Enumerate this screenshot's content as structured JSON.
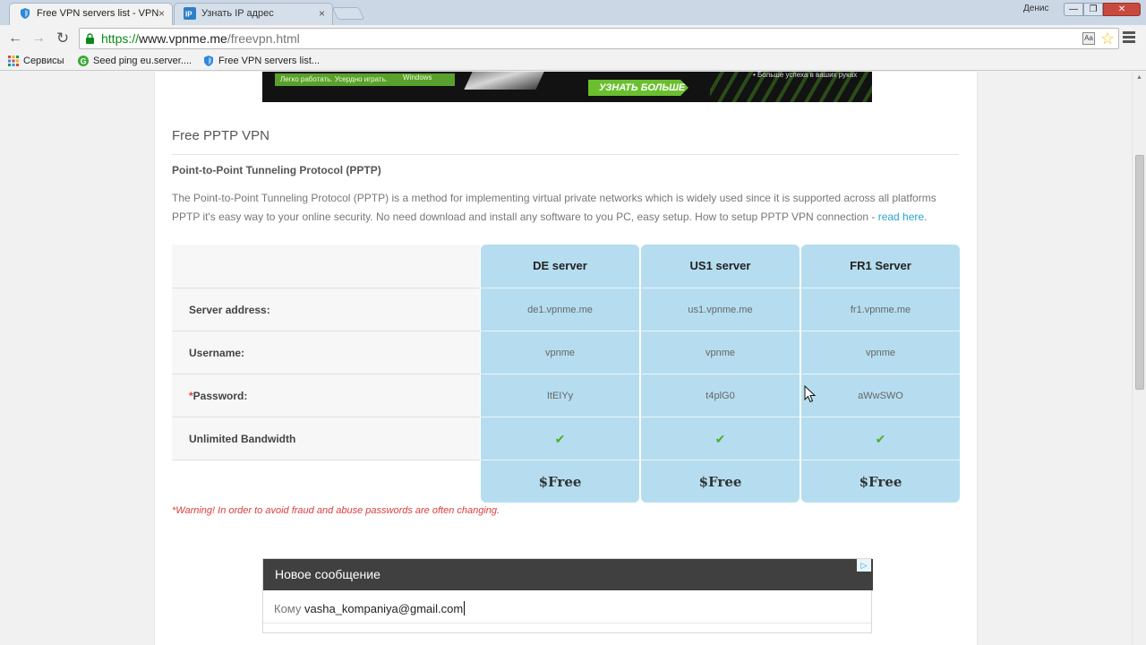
{
  "browser": {
    "tabs": [
      {
        "title": "Free VPN servers list - VPN",
        "close": "×"
      },
      {
        "title": "Узнать IP адрес",
        "close": "×"
      }
    ],
    "user_name": "Денис",
    "window_buttons": {
      "minimize": "—",
      "maximize": "❐",
      "close": "✕"
    },
    "url": {
      "scheme": "https://",
      "host": "www.vpnme.me",
      "path": "/freevpn.html"
    },
    "nav": {
      "back": "←",
      "forward": "→",
      "reload": "↻"
    },
    "bookmarks": [
      "Сервисы",
      "Seed ping eu.server....",
      "Free VPN servers list..."
    ]
  },
  "banner": {
    "chip_text": "Легко работать. Усердно играть.",
    "chip_os": "Windows",
    "cta": "УЗНАТЬ БОЛЬШЕ",
    "tagline": "• Больше успеха в ваших руках"
  },
  "section": {
    "title": "Free PPTP VPN",
    "heading": "Point-to-Point Tunneling Protocol (PPTP)",
    "intro": "The Point-to-Point Tunneling Protocol (PPTP) is a method for implementing virtual private networks which is widely used since it is supported across all platforms PPTP it's easy way to your online security. No need download and install any software to you PC, easy setup. How to setup PPTP VPN connection - ",
    "link": "read here",
    "intro_end": "."
  },
  "table": {
    "row_labels": [
      "Server address:",
      "Username:",
      "Password:",
      "Unlimited Bandwidth"
    ],
    "required_mark": "*",
    "check_glyph": "✔",
    "servers": [
      {
        "name": "DE server",
        "address": "de1.vpnme.me",
        "username": "vpnme",
        "password": "ItEIYy",
        "price": "$Free"
      },
      {
        "name": "US1 server",
        "address": "us1.vpnme.me",
        "username": "vpnme",
        "password": "t4plG0",
        "price": "$Free"
      },
      {
        "name": "FR1 Server",
        "address": "fr1.vpnme.me",
        "username": "vpnme",
        "password": "aWwSWO",
        "price": "$Free"
      }
    ]
  },
  "warning": "*Warning! In order to avoid fraud and abuse passwords are often changing.",
  "mail_ad": {
    "header": "Новое сообщение",
    "to_label": "Кому ",
    "to_value": "vasha_kompaniya@gmail.com",
    "adchoice": "▷"
  },
  "colors": {
    "server_column": "#b5ddef",
    "link": "#2aa3d3",
    "warning": "#dd3c3c",
    "check": "#4bae2a"
  }
}
